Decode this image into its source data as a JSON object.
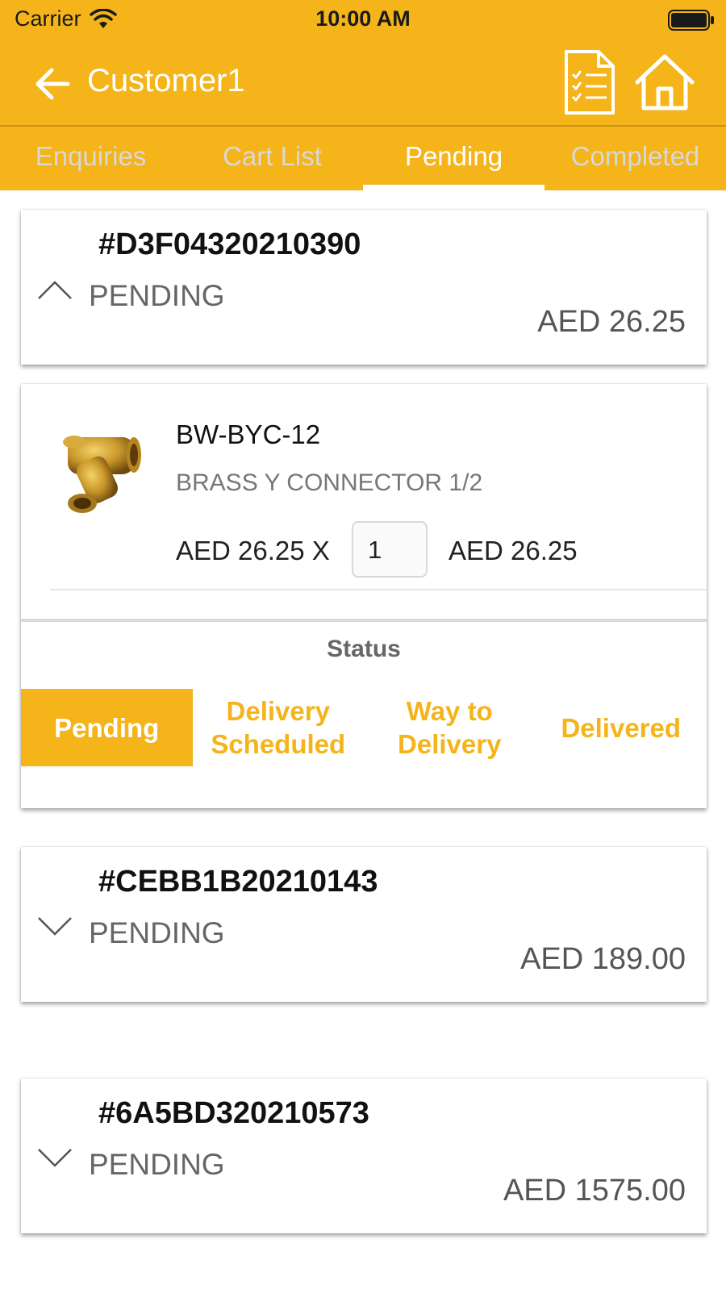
{
  "status_bar": {
    "carrier": "Carrier",
    "time": "10:00 AM"
  },
  "nav": {
    "title": "Customer1"
  },
  "tabs": [
    {
      "label": "Enquiries"
    },
    {
      "label": "Cart List"
    },
    {
      "label": "Pending"
    },
    {
      "label": "Completed"
    }
  ],
  "active_tab": "Pending",
  "orders": [
    {
      "id": "#D3F04320210390",
      "status": "PENDING",
      "amount": "AED 26.25",
      "expanded": true
    },
    {
      "id": "#CEBB1B20210143",
      "status": "PENDING",
      "amount": "AED 189.00",
      "expanded": false
    },
    {
      "id": "#6A5BD320210573",
      "status": "PENDING",
      "amount": "AED 1575.00",
      "expanded": false
    }
  ],
  "item": {
    "sku": "BW-BYC-12",
    "name": "BRASS Y CONNECTOR 1/2",
    "unit_price": "AED 26.25 X",
    "quantity": "1",
    "line_total": "AED 26.25"
  },
  "status_section": {
    "label": "Status",
    "steps": [
      {
        "line1": "Pending",
        "line2": ""
      },
      {
        "line1": "Delivery",
        "line2": "Scheduled"
      },
      {
        "line1": "Way to",
        "line2": "Delivery"
      },
      {
        "line1": "Delivered",
        "line2": ""
      }
    ],
    "active_step": "Pending"
  },
  "colors": {
    "accent": "#F4B41A",
    "tab_inactive": "#d8d8d8"
  },
  "icons": {
    "back": "arrow-left-icon",
    "orders": "document-checklist-icon",
    "home": "home-icon",
    "collapse": "chevron-up-icon",
    "expand": "chevron-down-icon"
  }
}
